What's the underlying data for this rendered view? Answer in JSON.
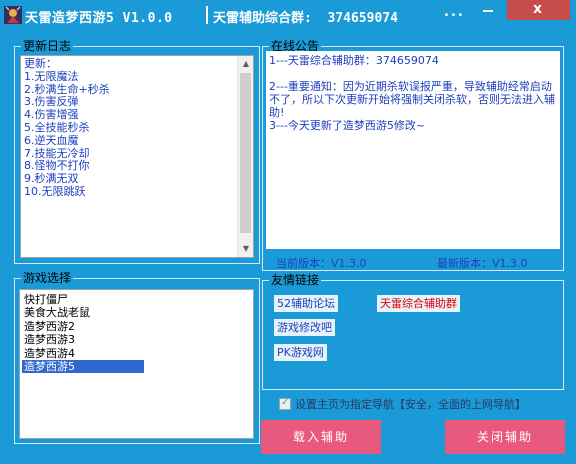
{
  "titlebar": {
    "title": "天雷造梦西游5 V1.0.0",
    "group": "天雷辅助综合群:  374659074",
    "dots": "...",
    "close": "x"
  },
  "update_log": {
    "title": "更新日志",
    "lines": [
      "更新：",
      "1.无限魔法",
      "2.秒满生命+秒杀",
      "3.伤害反弹",
      "4.伤害增强",
      "5.全技能秒杀",
      "6.逆天血魔",
      "7.技能无冷却",
      "8.怪物不打你",
      "9.秒满无双",
      "10.无限跳跃"
    ]
  },
  "notice": {
    "title": "在线公告",
    "lines": [
      "1---天雷综合辅助群：374659074",
      "",
      "2---重要通知：因为近期杀软误报严重，导致辅助经常启动不了，所以下次更新开始将强制关闭杀软，否则无法进入辅助!",
      "3---今天更新了造梦西游5修改~"
    ],
    "current_version": "当前版本：V1.3.0",
    "latest_version": "最新版本：V1.3.0"
  },
  "game_select": {
    "title": "游戏选择",
    "items": [
      "快打僵尸",
      "美食大战老鼠",
      "造梦西游2",
      "造梦西游3",
      "造梦西游4",
      "造梦西游5"
    ],
    "selected_index": 5
  },
  "links": {
    "title": "友情链接",
    "items": [
      "52辅助论坛",
      "天雷综合辅助群",
      "游戏修改吧",
      "PK游戏网"
    ]
  },
  "homepage_option": {
    "label": "设置主页为指定导航【安全，全面的上网导航】",
    "checked": true
  },
  "buttons": {
    "load": "载入辅助",
    "close": "关闭辅助"
  },
  "colors": {
    "background": "#1a9ad6",
    "log_text": "#1d3fbe",
    "highlight_link": "#e00000",
    "button": "#e9597d",
    "close_button": "#c74c4c",
    "selection": "#3167cf"
  }
}
